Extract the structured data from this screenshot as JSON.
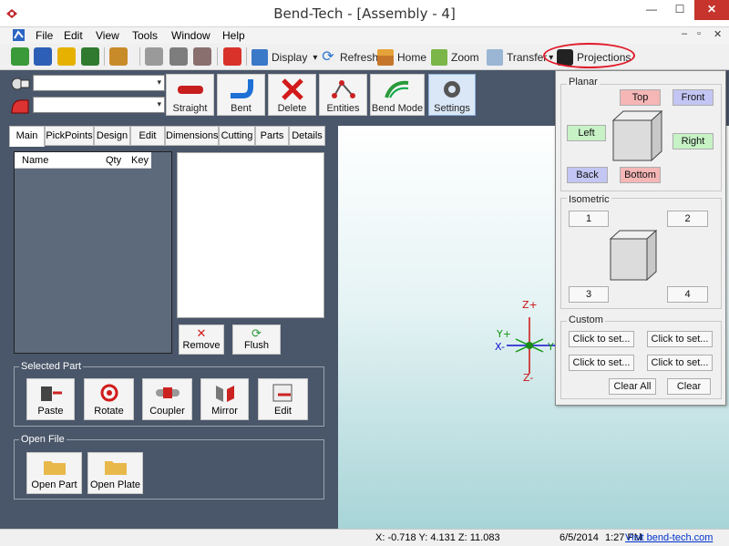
{
  "window": {
    "title": "Bend-Tech - [Assembly - 4]",
    "minimize": "—",
    "maximize": "☐",
    "close": "✕"
  },
  "menu": {
    "items": [
      "File",
      "Edit",
      "View",
      "Tools",
      "Window",
      "Help"
    ],
    "mdi_controls": [
      "–",
      "▫",
      "✕"
    ]
  },
  "toolbar": {
    "display": "Display",
    "refresh": "Refresh",
    "home": "Home",
    "zoom": "Zoom",
    "transfer": "Transfer",
    "projections": "Projections",
    "dropdown_arrow": "▾"
  },
  "toolbar2": {
    "combo1_value": "",
    "combo2_value": "",
    "arrow": "▾",
    "buttons": [
      "Straight",
      "Bent",
      "Delete",
      "Entities",
      "Bend Mode",
      "Settings"
    ]
  },
  "tabs": [
    "Main",
    "PickPoints",
    "Design",
    "Edit",
    "Dimensions",
    "Cutting",
    "Parts",
    "Details"
  ],
  "parts_list": {
    "columns": [
      "Name",
      "Qty",
      "Key"
    ]
  },
  "list_buttons": {
    "remove": "Remove",
    "flush": "Flush"
  },
  "selected_part": {
    "label": "Selected Part",
    "buttons": [
      "Paste",
      "Rotate",
      "Coupler",
      "Mirror",
      "Edit"
    ]
  },
  "open_file": {
    "label": "Open File",
    "buttons": [
      "Open Part",
      "Open Plate"
    ]
  },
  "axes": {
    "z_plus": "Z+",
    "z_minus": "Z-",
    "y_plus": "Y+",
    "x_minus": "X-",
    "y_partial": "Y"
  },
  "status": {
    "coords": "X: -0.718  Y: 4.131  Z: 11.083",
    "date": "6/5/2014",
    "time": "1:27 PM",
    "link": "Visit bend-tech.com"
  },
  "projections": {
    "planar_label": "Planar",
    "top": "Top",
    "front": "Front",
    "left": "Left",
    "right": "Right",
    "back": "Back",
    "bottom": "Bottom",
    "isometric_label": "Isometric",
    "iso": [
      "1",
      "2",
      "3",
      "4"
    ],
    "custom_label": "Custom",
    "custom_slots": [
      "Click to set...",
      "Click to set...",
      "Click to set...",
      "Click to set..."
    ],
    "clear_all": "Clear All",
    "clear": "Clear"
  },
  "colors": {
    "panel_bg": "#4a5669",
    "highlight": "#e11a2a",
    "close_red": "#c7342d",
    "pink": "#f5b6b6",
    "lavender": "#c3c6f3",
    "green": "#c6f2c6"
  }
}
